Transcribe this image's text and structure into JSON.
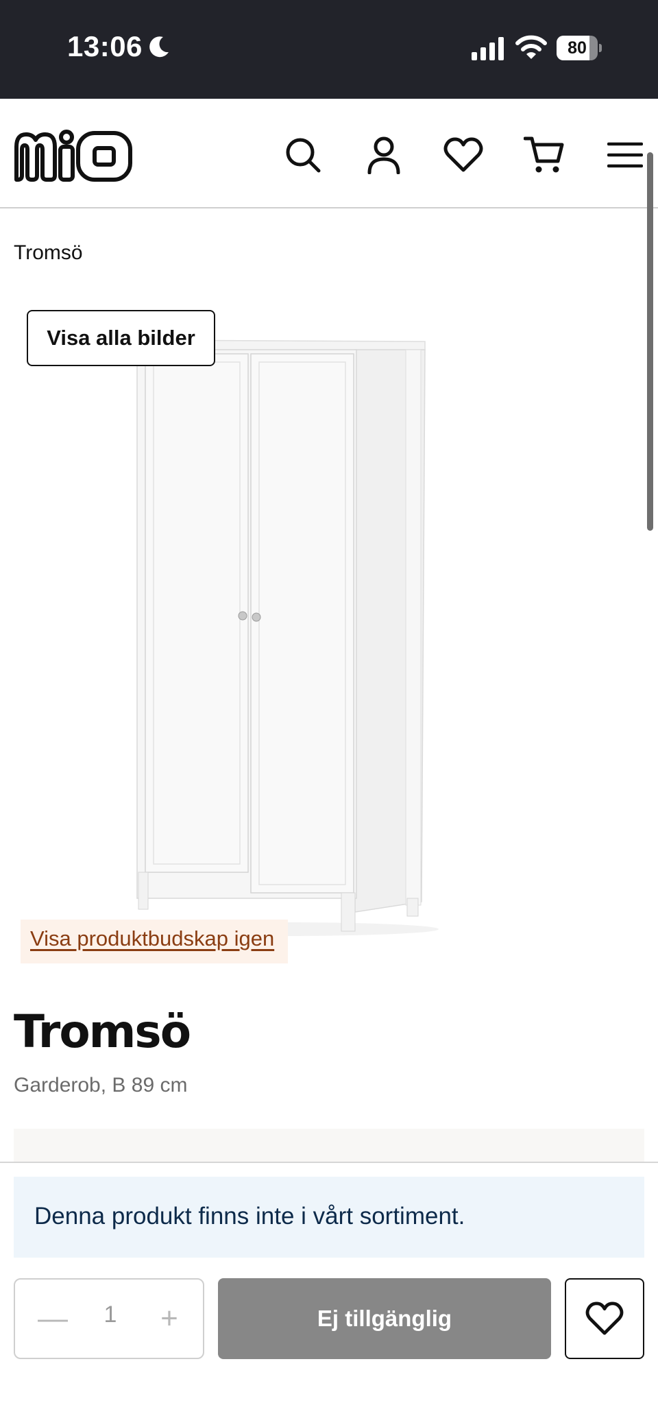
{
  "status_bar": {
    "time": "13:06",
    "battery": "80",
    "battery_level": 0.8,
    "icons": [
      "moon-icon",
      "signal-icon",
      "wifi-icon",
      "battery-icon"
    ]
  },
  "header": {
    "logo_text": "mio",
    "icons": [
      "search-icon",
      "account-icon",
      "heart-icon",
      "cart-icon",
      "menu-icon"
    ]
  },
  "breadcrumb": "Tromsö",
  "gallery": {
    "show_all_label": "Visa alla bilder",
    "product_messages_link": "Visa produktbudskap igen"
  },
  "product": {
    "name": "Tromsö",
    "subtitle": "Garderob, B 89 cm"
  },
  "purchase": {
    "notice": "Denna produkt finns inte i vårt sortiment.",
    "quantity": "1",
    "minus_symbol": "—",
    "plus_symbol": "+",
    "buy_label": "Ej tillgänglig"
  },
  "colors": {
    "status_bar_bg": "#22232a",
    "notice_bg": "#eef5fb",
    "notice_text": "#0d2a4a",
    "link_color": "#8a3d12",
    "link_bg": "#fdf2ea",
    "disabled_button": "#878787"
  }
}
